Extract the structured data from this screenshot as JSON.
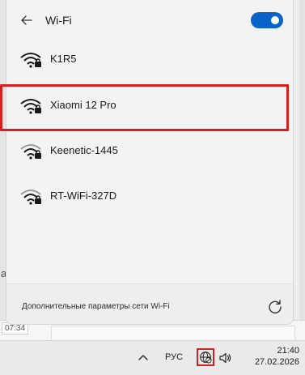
{
  "header": {
    "title": "Wi-Fi",
    "back_icon": "arrow-left-icon",
    "toggle_on": true,
    "accent_color": "#0a63c9"
  },
  "networks": [
    {
      "ssid": "K1R5",
      "icon": "wifi-secured-icon",
      "highlighted": false
    },
    {
      "ssid": "Xiaomi 12 Pro",
      "icon": "wifi-secured-icon",
      "highlighted": true
    },
    {
      "ssid": "Keenetic-1445",
      "icon": "wifi-secured-icon",
      "highlighted": false
    },
    {
      "ssid": "RT-WiFi-327D",
      "icon": "wifi-secured-icon",
      "highlighted": false
    }
  ],
  "footer": {
    "more_settings": "Дополнительные параметры сети Wi-Fi",
    "refresh_icon": "refresh-icon"
  },
  "background": {
    "time_chip": "07:34",
    "edge_letter": "а"
  },
  "taskbar": {
    "chevron_icon": "chevron-up-icon",
    "language": "РУС",
    "network_icon": "globe-no-internet-icon",
    "volume_icon": "speaker-icon",
    "time": "21:40",
    "date": "27.02.2026"
  },
  "colors": {
    "highlight": "#d42020"
  }
}
